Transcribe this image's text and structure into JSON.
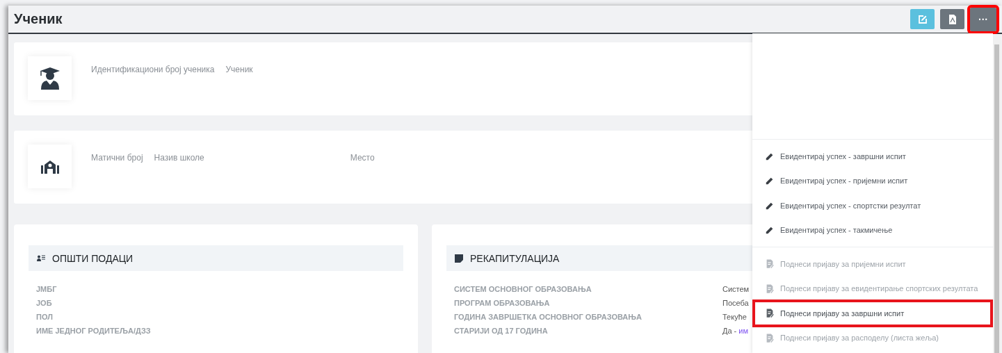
{
  "page": {
    "title": "Ученик"
  },
  "toolbar": {
    "buttons": [
      {
        "kind": "edit",
        "highlighted": false
      },
      {
        "kind": "pdf",
        "highlighted": false
      },
      {
        "kind": "more",
        "label": "···",
        "highlighted": true
      }
    ]
  },
  "student_card": {
    "fields": [
      "Идентификациони број ученика",
      "Ученик"
    ]
  },
  "school_card": {
    "fields": [
      "Матични број",
      "Назив школе",
      "Место"
    ]
  },
  "general_panel": {
    "title": "ОПШТИ ПОДАЦИ",
    "rows": [
      {
        "label": "ЈМБГ"
      },
      {
        "label": "ЈОБ"
      },
      {
        "label": "ПОЛ"
      },
      {
        "label": "ИМЕ ЈЕДНОГ РОДИТЕЉА/ДЗЗ"
      }
    ]
  },
  "recap_panel": {
    "title": "РЕКАПИТУЛАЦИЈА",
    "rows": [
      {
        "label": "СИСТЕМ ОСНОВНОГ ОБРАЗОВАЊА",
        "value": "Систем"
      },
      {
        "label": "ПРОГРАМ ОБРАЗОВАЊА",
        "value": "Посеба"
      },
      {
        "label": "ГОДИНА ЗАВРШЕТКА ОСНОВНОГ ОБРАЗОВАЊА",
        "value": "Текуће"
      },
      {
        "label": "СТАРИЈИ ОД 17 ГОДИНА",
        "value": "Да -",
        "link": "им"
      }
    ]
  },
  "dropdown_menu": {
    "groups": [
      [
        {
          "kind": "edit",
          "label": "Евидентирај успех - завршни испит",
          "disabled": false,
          "highlighted": false
        },
        {
          "kind": "edit",
          "label": "Евидентирај успех - пријемни испит",
          "disabled": false,
          "highlighted": false
        },
        {
          "kind": "edit",
          "label": "Евидентирај успех - спортстки резултат",
          "disabled": false,
          "highlighted": false
        },
        {
          "kind": "edit",
          "label": "Евидентирај успех - такмичење",
          "disabled": false,
          "highlighted": false
        }
      ],
      [
        {
          "kind": "submit",
          "label": "Поднеси пријаву за пријемни испит",
          "disabled": true,
          "highlighted": false
        },
        {
          "kind": "submit",
          "label": "Поднеси пријаву за евидентирање спортских резултата",
          "disabled": true,
          "highlighted": false
        },
        {
          "kind": "submit",
          "label": "Поднеси пријаву за завршни испит",
          "disabled": false,
          "highlighted": true
        },
        {
          "kind": "submit",
          "label": "Поднеси пријаву за расподелу (листа жеља)",
          "disabled": true,
          "highlighted": false
        }
      ]
    ]
  }
}
